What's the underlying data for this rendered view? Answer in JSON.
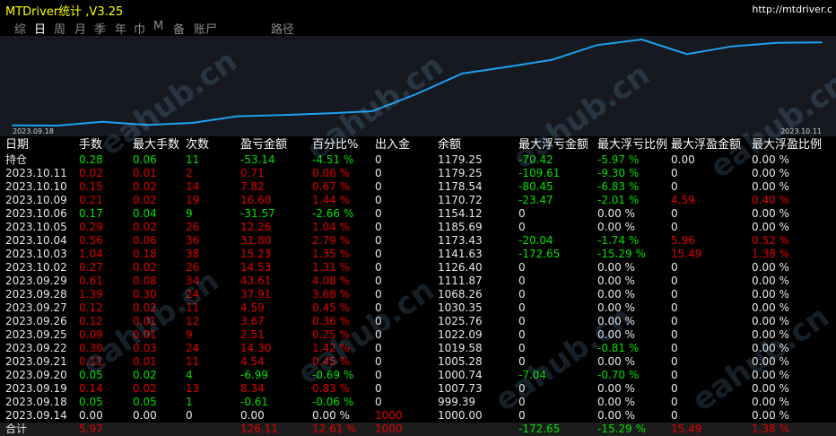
{
  "window": {
    "title": "MTDriver统计 ,V3.25",
    "url": "http://mtdriver.c"
  },
  "tabs": [
    {
      "label": "综"
    },
    {
      "label": "日",
      "active": true
    },
    {
      "label": "周"
    },
    {
      "label": "月"
    },
    {
      "label": "季"
    },
    {
      "label": "年"
    },
    {
      "label": "巾"
    },
    {
      "label": "M"
    },
    {
      "label": "备"
    },
    {
      "label": "账尸"
    },
    {
      "label": "路径"
    }
  ],
  "chart_data": {
    "type": "line",
    "x_start_label": "2023.09.18",
    "x_end_label": "2023.10.11",
    "series": [
      {
        "values": [
          1000,
          999.39,
          1007.73,
          1000.74,
          1005.28,
          1019.58,
          1022.09,
          1025.76,
          1030.35,
          1068.26,
          1111.87,
          1126.4,
          1141.63,
          1173.43,
          1185.69,
          1154.12,
          1170.72,
          1178.54,
          1179.25
        ]
      }
    ],
    "grid": false,
    "line_color": "#1ea0f0"
  },
  "watermark": "eahub.cn",
  "table": {
    "headers": [
      "日期",
      "手数",
      "最大手数",
      "次数",
      "盈亏金额",
      "百分比%",
      "出入金",
      "余额",
      "最大浮亏金额",
      "最大浮亏比例",
      "最大浮盈金额",
      "最大浮盈比例"
    ],
    "rows": [
      [
        {
          "t": "持仓",
          "c": "white"
        },
        {
          "t": "0.28",
          "c": "green"
        },
        {
          "t": "0.06",
          "c": "green"
        },
        {
          "t": "11",
          "c": "green"
        },
        {
          "t": "-53.14",
          "c": "green"
        },
        {
          "t": "-4.51 %",
          "c": "green"
        },
        {
          "t": "0",
          "c": "white"
        },
        {
          "t": "1179.25",
          "c": "white"
        },
        {
          "t": "-70.42",
          "c": "green"
        },
        {
          "t": "-5.97 %",
          "c": "green"
        },
        {
          "t": "0.00",
          "c": "white"
        },
        {
          "t": "0.00 %",
          "c": "white"
        }
      ],
      [
        {
          "t": "2023.10.11",
          "c": "white"
        },
        {
          "t": "0.02",
          "c": "red"
        },
        {
          "t": "0.01",
          "c": "red"
        },
        {
          "t": "2",
          "c": "red"
        },
        {
          "t": "0.71",
          "c": "red"
        },
        {
          "t": "0.06 %",
          "c": "red"
        },
        {
          "t": "0",
          "c": "white"
        },
        {
          "t": "1179.25",
          "c": "white"
        },
        {
          "t": "-109.61",
          "c": "green"
        },
        {
          "t": "-9.30 %",
          "c": "green"
        },
        {
          "t": "0",
          "c": "white"
        },
        {
          "t": "0.00 %",
          "c": "white"
        }
      ],
      [
        {
          "t": "2023.10.10",
          "c": "white"
        },
        {
          "t": "0.15",
          "c": "red"
        },
        {
          "t": "0.02",
          "c": "red"
        },
        {
          "t": "14",
          "c": "red"
        },
        {
          "t": "7.82",
          "c": "red"
        },
        {
          "t": "0.67 %",
          "c": "red"
        },
        {
          "t": "0",
          "c": "white"
        },
        {
          "t": "1178.54",
          "c": "white"
        },
        {
          "t": "-80.45",
          "c": "green"
        },
        {
          "t": "-6.83 %",
          "c": "green"
        },
        {
          "t": "0",
          "c": "white"
        },
        {
          "t": "0.00 %",
          "c": "white"
        }
      ],
      [
        {
          "t": "2023.10.09",
          "c": "white"
        },
        {
          "t": "0.21",
          "c": "red"
        },
        {
          "t": "0.02",
          "c": "red"
        },
        {
          "t": "19",
          "c": "red"
        },
        {
          "t": "16.60",
          "c": "red"
        },
        {
          "t": "1.44 %",
          "c": "red"
        },
        {
          "t": "0",
          "c": "white"
        },
        {
          "t": "1170.72",
          "c": "white"
        },
        {
          "t": "-23.47",
          "c": "green"
        },
        {
          "t": "-2.01 %",
          "c": "green"
        },
        {
          "t": "4.59",
          "c": "red"
        },
        {
          "t": "0.40 %",
          "c": "red"
        }
      ],
      [
        {
          "t": "2023.10.06",
          "c": "white"
        },
        {
          "t": "0.17",
          "c": "green"
        },
        {
          "t": "0.04",
          "c": "green"
        },
        {
          "t": "9",
          "c": "green"
        },
        {
          "t": "-31.57",
          "c": "green"
        },
        {
          "t": "-2.66 %",
          "c": "green"
        },
        {
          "t": "0",
          "c": "white"
        },
        {
          "t": "1154.12",
          "c": "white"
        },
        {
          "t": "0",
          "c": "white"
        },
        {
          "t": "0.00 %",
          "c": "white"
        },
        {
          "t": "0",
          "c": "white"
        },
        {
          "t": "0.00 %",
          "c": "white"
        }
      ],
      [
        {
          "t": "2023.10.05",
          "c": "white"
        },
        {
          "t": "0.29",
          "c": "red"
        },
        {
          "t": "0.02",
          "c": "red"
        },
        {
          "t": "26",
          "c": "red"
        },
        {
          "t": "12.26",
          "c": "red"
        },
        {
          "t": "1.04 %",
          "c": "red"
        },
        {
          "t": "0",
          "c": "white"
        },
        {
          "t": "1185.69",
          "c": "white"
        },
        {
          "t": "0",
          "c": "white"
        },
        {
          "t": "0.00 %",
          "c": "white"
        },
        {
          "t": "0",
          "c": "white"
        },
        {
          "t": "0.00 %",
          "c": "white"
        }
      ],
      [
        {
          "t": "2023.10.04",
          "c": "white"
        },
        {
          "t": "0.56",
          "c": "red"
        },
        {
          "t": "0.06",
          "c": "red"
        },
        {
          "t": "36",
          "c": "red"
        },
        {
          "t": "31.80",
          "c": "red"
        },
        {
          "t": "2.79 %",
          "c": "red"
        },
        {
          "t": "0",
          "c": "white"
        },
        {
          "t": "1173.43",
          "c": "white"
        },
        {
          "t": "-20.04",
          "c": "green"
        },
        {
          "t": "-1.74 %",
          "c": "green"
        },
        {
          "t": "5.96",
          "c": "red"
        },
        {
          "t": "0.52 %",
          "c": "red"
        }
      ],
      [
        {
          "t": "2023.10.03",
          "c": "white"
        },
        {
          "t": "1.04",
          "c": "red"
        },
        {
          "t": "0.18",
          "c": "red"
        },
        {
          "t": "38",
          "c": "red"
        },
        {
          "t": "15.23",
          "c": "red"
        },
        {
          "t": "1.35 %",
          "c": "red"
        },
        {
          "t": "0",
          "c": "white"
        },
        {
          "t": "1141.63",
          "c": "white"
        },
        {
          "t": "-172.65",
          "c": "green"
        },
        {
          "t": "-15.29 %",
          "c": "green"
        },
        {
          "t": "15.49",
          "c": "red"
        },
        {
          "t": "1.38 %",
          "c": "red"
        }
      ],
      [
        {
          "t": "2023.10.02",
          "c": "white"
        },
        {
          "t": "0.27",
          "c": "red"
        },
        {
          "t": "0.02",
          "c": "red"
        },
        {
          "t": "26",
          "c": "red"
        },
        {
          "t": "14.53",
          "c": "red"
        },
        {
          "t": "1.31 %",
          "c": "red"
        },
        {
          "t": "0",
          "c": "white"
        },
        {
          "t": "1126.40",
          "c": "white"
        },
        {
          "t": "0",
          "c": "white"
        },
        {
          "t": "0.00 %",
          "c": "white"
        },
        {
          "t": "0",
          "c": "white"
        },
        {
          "t": "0.00 %",
          "c": "white"
        }
      ],
      [
        {
          "t": "2023.09.29",
          "c": "white"
        },
        {
          "t": "0.61",
          "c": "red"
        },
        {
          "t": "0.08",
          "c": "red"
        },
        {
          "t": "34",
          "c": "red"
        },
        {
          "t": "43.61",
          "c": "red"
        },
        {
          "t": "4.08 %",
          "c": "red"
        },
        {
          "t": "0",
          "c": "white"
        },
        {
          "t": "1111.87",
          "c": "white"
        },
        {
          "t": "0",
          "c": "white"
        },
        {
          "t": "0.00 %",
          "c": "white"
        },
        {
          "t": "0",
          "c": "white"
        },
        {
          "t": "0.00 %",
          "c": "white"
        }
      ],
      [
        {
          "t": "2023.09.28",
          "c": "white"
        },
        {
          "t": "1.39",
          "c": "red"
        },
        {
          "t": "0.30",
          "c": "red"
        },
        {
          "t": "24",
          "c": "red"
        },
        {
          "t": "37.91",
          "c": "red"
        },
        {
          "t": "3.68 %",
          "c": "red"
        },
        {
          "t": "0",
          "c": "white"
        },
        {
          "t": "1068.26",
          "c": "white"
        },
        {
          "t": "0",
          "c": "white"
        },
        {
          "t": "0.00 %",
          "c": "white"
        },
        {
          "t": "0",
          "c": "white"
        },
        {
          "t": "0.00 %",
          "c": "white"
        }
      ],
      [
        {
          "t": "2023.09.27",
          "c": "white"
        },
        {
          "t": "0.12",
          "c": "red"
        },
        {
          "t": "0.02",
          "c": "red"
        },
        {
          "t": "11",
          "c": "red"
        },
        {
          "t": "4.59",
          "c": "red"
        },
        {
          "t": "0.45 %",
          "c": "red"
        },
        {
          "t": "0",
          "c": "white"
        },
        {
          "t": "1030.35",
          "c": "white"
        },
        {
          "t": "0",
          "c": "white"
        },
        {
          "t": "0.00 %",
          "c": "white"
        },
        {
          "t": "0",
          "c": "white"
        },
        {
          "t": "0.00 %",
          "c": "white"
        }
      ],
      [
        {
          "t": "2023.09.26",
          "c": "white"
        },
        {
          "t": "0.12",
          "c": "red"
        },
        {
          "t": "0.01",
          "c": "red"
        },
        {
          "t": "12",
          "c": "red"
        },
        {
          "t": "3.67",
          "c": "red"
        },
        {
          "t": "0.36 %",
          "c": "red"
        },
        {
          "t": "0",
          "c": "white"
        },
        {
          "t": "1025.76",
          "c": "white"
        },
        {
          "t": "0",
          "c": "white"
        },
        {
          "t": "0.00 %",
          "c": "white"
        },
        {
          "t": "0",
          "c": "white"
        },
        {
          "t": "0.00 %",
          "c": "white"
        }
      ],
      [
        {
          "t": "2023.09.25",
          "c": "white"
        },
        {
          "t": "0.09",
          "c": "red"
        },
        {
          "t": "0.01",
          "c": "red"
        },
        {
          "t": "9",
          "c": "red"
        },
        {
          "t": "2.51",
          "c": "red"
        },
        {
          "t": "0.25 %",
          "c": "red"
        },
        {
          "t": "0",
          "c": "white"
        },
        {
          "t": "1022.09",
          "c": "white"
        },
        {
          "t": "0",
          "c": "white"
        },
        {
          "t": "0.00 %",
          "c": "white"
        },
        {
          "t": "0",
          "c": "white"
        },
        {
          "t": "0.00 %",
          "c": "white"
        }
      ],
      [
        {
          "t": "2023.09.22",
          "c": "white"
        },
        {
          "t": "0.30",
          "c": "red"
        },
        {
          "t": "0.03",
          "c": "red"
        },
        {
          "t": "24",
          "c": "red"
        },
        {
          "t": "14.30",
          "c": "red"
        },
        {
          "t": "1.42 %",
          "c": "red"
        },
        {
          "t": "0",
          "c": "white"
        },
        {
          "t": "1019.58",
          "c": "white"
        },
        {
          "t": "0",
          "c": "white"
        },
        {
          "t": "-0.81 %",
          "c": "green"
        },
        {
          "t": "0",
          "c": "white"
        },
        {
          "t": "0.00 %",
          "c": "white"
        }
      ],
      [
        {
          "t": "2023.09.21",
          "c": "white"
        },
        {
          "t": "0.11",
          "c": "red"
        },
        {
          "t": "0.01",
          "c": "red"
        },
        {
          "t": "11",
          "c": "red"
        },
        {
          "t": "4.54",
          "c": "red"
        },
        {
          "t": "0.45 %",
          "c": "red"
        },
        {
          "t": "0",
          "c": "white"
        },
        {
          "t": "1005.28",
          "c": "white"
        },
        {
          "t": "0",
          "c": "white"
        },
        {
          "t": "0.00 %",
          "c": "white"
        },
        {
          "t": "0",
          "c": "white"
        },
        {
          "t": "0.00 %",
          "c": "white"
        }
      ],
      [
        {
          "t": "2023.09.20",
          "c": "white"
        },
        {
          "t": "0.05",
          "c": "green"
        },
        {
          "t": "0.02",
          "c": "green"
        },
        {
          "t": "4",
          "c": "green"
        },
        {
          "t": "-6.99",
          "c": "green"
        },
        {
          "t": "-0.69 %",
          "c": "green"
        },
        {
          "t": "0",
          "c": "white"
        },
        {
          "t": "1000.74",
          "c": "white"
        },
        {
          "t": "-7.04",
          "c": "green"
        },
        {
          "t": "-0.70 %",
          "c": "green"
        },
        {
          "t": "0",
          "c": "white"
        },
        {
          "t": "0.00 %",
          "c": "white"
        }
      ],
      [
        {
          "t": "2023.09.19",
          "c": "white"
        },
        {
          "t": "0.14",
          "c": "red"
        },
        {
          "t": "0.02",
          "c": "red"
        },
        {
          "t": "13",
          "c": "red"
        },
        {
          "t": "8.34",
          "c": "red"
        },
        {
          "t": "0.83 %",
          "c": "red"
        },
        {
          "t": "0",
          "c": "white"
        },
        {
          "t": "1007.73",
          "c": "white"
        },
        {
          "t": "0",
          "c": "white"
        },
        {
          "t": "0.00 %",
          "c": "white"
        },
        {
          "t": "0",
          "c": "white"
        },
        {
          "t": "0.00 %",
          "c": "white"
        }
      ],
      [
        {
          "t": "2023.09.18",
          "c": "white"
        },
        {
          "t": "0.05",
          "c": "green"
        },
        {
          "t": "0.05",
          "c": "green"
        },
        {
          "t": "1",
          "c": "green"
        },
        {
          "t": "-0.61",
          "c": "green"
        },
        {
          "t": "-0.06 %",
          "c": "green"
        },
        {
          "t": "0",
          "c": "white"
        },
        {
          "t": "999.39",
          "c": "white"
        },
        {
          "t": "0",
          "c": "white"
        },
        {
          "t": "0.00 %",
          "c": "white"
        },
        {
          "t": "0",
          "c": "white"
        },
        {
          "t": "0.00 %",
          "c": "white"
        }
      ],
      [
        {
          "t": "2023.09.14",
          "c": "white"
        },
        {
          "t": "0.00",
          "c": "white"
        },
        {
          "t": "0.00",
          "c": "white"
        },
        {
          "t": "0",
          "c": "white"
        },
        {
          "t": "0.00",
          "c": "white"
        },
        {
          "t": "0.00 %",
          "c": "white"
        },
        {
          "t": "1000",
          "c": "red"
        },
        {
          "t": "1000.00",
          "c": "white"
        },
        {
          "t": "0",
          "c": "white"
        },
        {
          "t": "0.00 %",
          "c": "white"
        },
        {
          "t": "0",
          "c": "white"
        },
        {
          "t": "0.00 %",
          "c": "white"
        }
      ]
    ],
    "total": [
      {
        "t": "合计",
        "c": "white"
      },
      {
        "t": "5.97",
        "c": "red"
      },
      {
        "t": "",
        "c": "white"
      },
      {
        "t": "",
        "c": "white"
      },
      {
        "t": "126.11",
        "c": "red"
      },
      {
        "t": "12.61 %",
        "c": "red"
      },
      {
        "t": "1000",
        "c": "red"
      },
      {
        "t": "",
        "c": "white"
      },
      {
        "t": "-172.65",
        "c": "green"
      },
      {
        "t": "-15.29 %",
        "c": "green"
      },
      {
        "t": "15.49",
        "c": "red"
      },
      {
        "t": "1.38 %",
        "c": "red"
      }
    ]
  }
}
